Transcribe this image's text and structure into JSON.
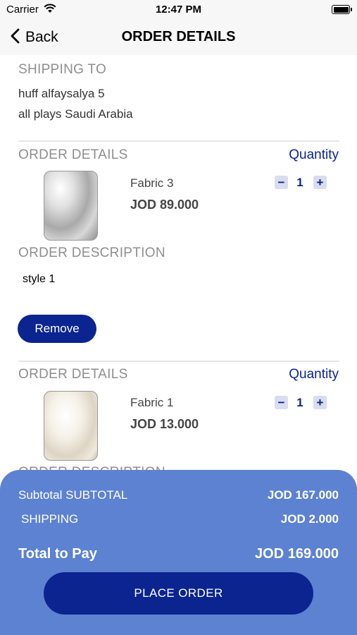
{
  "status_bar": {
    "carrier": "Carrier",
    "time": "12:47 PM"
  },
  "nav": {
    "back_label": "Back",
    "title": "ORDER DETAILS"
  },
  "shipping": {
    "heading": "SHIPPING TO",
    "line1": "huff alfaysalya 5",
    "line2": "all plays Saudi Arabia"
  },
  "items": [
    {
      "section_heading": "ORDER DETAILS",
      "quantity_heading": "Quantity",
      "name": "Fabric 3",
      "price": "JOD 89.000",
      "quantity": "1",
      "image": "gray-satin-fabric",
      "description_heading": "ORDER DESCRIPTION",
      "description": "style 1",
      "remove_label": "Remove"
    },
    {
      "section_heading": "ORDER DETAILS",
      "quantity_heading": "Quantity",
      "name": "Fabric 1",
      "price": "JOD 13.000",
      "quantity": "1",
      "image": "cream-satin-fabric",
      "description_heading": "ORDER DESCRIPTION"
    }
  ],
  "qty_controls": {
    "minus": "−",
    "plus": "+"
  },
  "summary": {
    "subtotal_label": "Subtotal SUBTOTAL",
    "subtotal_value": "JOD 167.000",
    "shipping_label": "SHIPPING",
    "shipping_value": "JOD 2.000",
    "total_label": "Total to Pay",
    "total_value": "JOD 169.000",
    "place_order_label": "PLACE ORDER"
  },
  "colors": {
    "primary": "#0b2490",
    "summary_panel": "#5d82d2",
    "heading_gray": "#8e8e8e"
  }
}
